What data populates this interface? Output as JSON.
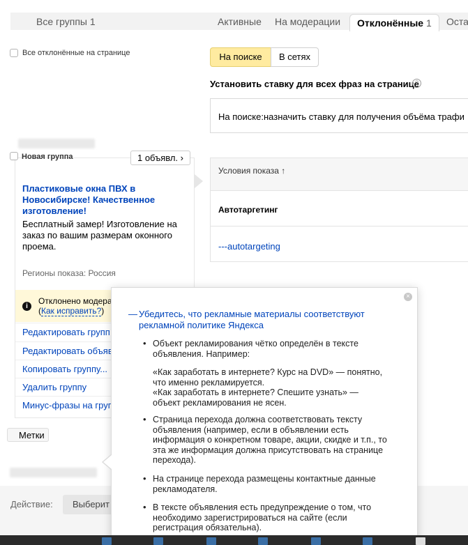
{
  "tabs": {
    "all_groups": "Все группы",
    "all_groups_count": "1",
    "active": "Активные",
    "moderation": "На модерации",
    "rejected": "Отклонённые",
    "rejected_count": "1",
    "stopped_partial": "Оста"
  },
  "select_all_label": "Все отклонённые на странице",
  "bid_mode": {
    "search": "На поиске",
    "networks": "В сетях"
  },
  "bid_heading": "Установить ставку для всех фраз на странице",
  "bid_help_icon": "question-circle-icon",
  "bid_row": {
    "label": "На поиске:",
    "value": "назначить ставку для получения объёма трафи"
  },
  "group": {
    "name": "Новая группа",
    "ads_button": "1 объявл.",
    "ad_title": "Пластиковые окна ПВХ в Новосибирске! Качественное изготовление!",
    "ad_text": "Бесплатный замер! Изготовление на заказ по вашим размерам оконного проема.",
    "regions": "Регионы показа: Россия",
    "rejected_status": "Отклонено модера",
    "how_to_fix": "Как исправить?",
    "menu": [
      "Редактировать групп",
      "Редактировать объяв",
      "Копировать группу...",
      "Удалить группу",
      "Минус-фразы на груп"
    ],
    "tags_button": "Метки"
  },
  "conditions": {
    "header": "Условия показа ↑",
    "autotargeting_label": "Автотаргетинг",
    "autotargeting_value": "---autotargeting"
  },
  "bottom": {
    "action_label": "Действие:",
    "select_value": "Выберит"
  },
  "popup": {
    "heading_dash": "—",
    "heading": "Убедитесь, что рекламные материалы соответствуют рекламной политике Яндекса",
    "items": [
      "Объект рекламирования чётко определён в тексте объявления. Например:",
      "Страница перехода должна соответствовать тексту объявления (например, если в объявлении есть информация о конкретном товаре, акции, скидке и т.п., то эта же информация должна присутствовать на странице перехода).",
      "На странице перехода размещены контактные данные рекламодателя.",
      "В тексте объявления есть предупреждение о том, что необходимо зарегистрироваться на сайте (если регистрация обязательна)."
    ],
    "example_good": "«Как заработать в интернете? Курс на DVD» — понятно, что именно рекламируется.",
    "example_bad": "«Как заработать в интернете? Спешите узнать» — объект рекламирования не ясен."
  },
  "colors": {
    "link": "#0044bb",
    "accent_yellow": "#ffeba0",
    "warning_bg": "#fff8d9"
  }
}
